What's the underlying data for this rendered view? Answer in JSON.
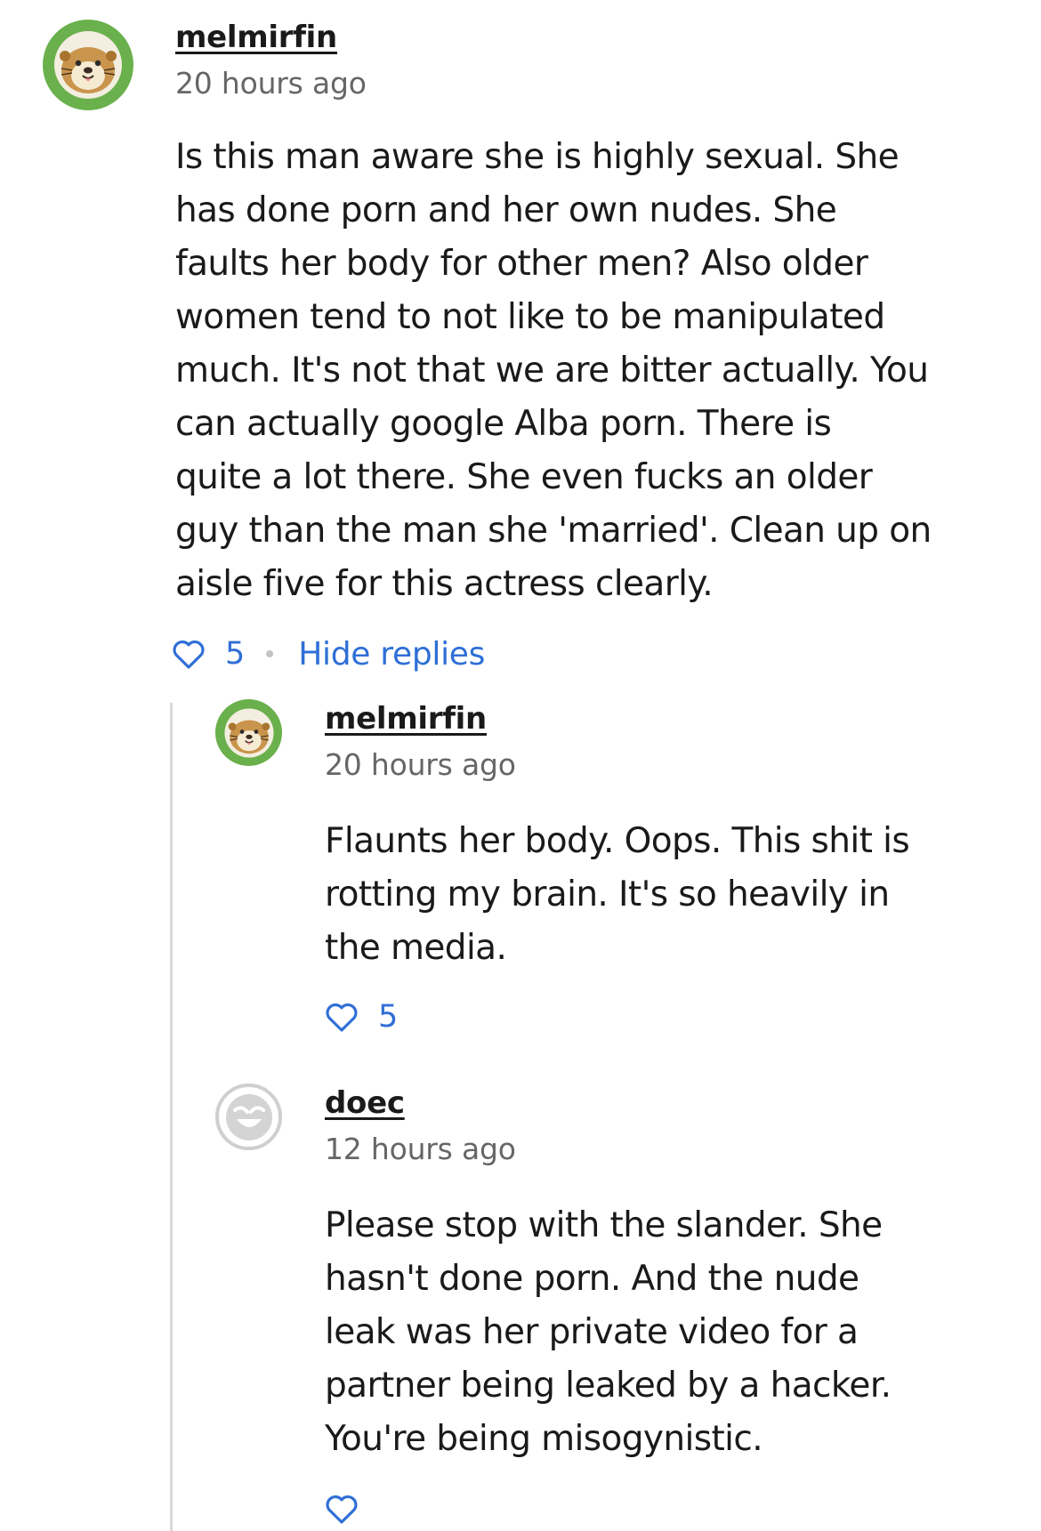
{
  "colors": {
    "link_blue": "#2f6fd6",
    "timestamp_gray": "#666666",
    "otter_avatar_green": "#6ab04c",
    "default_avatar_gray": "#bfbfbf"
  },
  "comment": {
    "username": "melmirfin",
    "timestamp": "20 hours ago",
    "avatar_icon": "otter-avatar-icon",
    "lines": [
      "Is this man aware she is highly sexual. She",
      "has done porn and her own nudes. She",
      "faults her body for other men? Also older",
      "women tend to not like to be manipulated",
      "much. It's not that we are bitter actually. You",
      "can actually google Alba porn. There is",
      "quite a lot there. She even fucks an older",
      "guy than the man she 'married'. Clean up on",
      "aisle five for this actress clearly."
    ],
    "likes": "5",
    "hide_replies_label": "Hide replies"
  },
  "replies": [
    {
      "username": "melmirfin",
      "timestamp": "20 hours ago",
      "avatar_icon": "otter-avatar-icon",
      "lines": [
        "Flaunts her body. Oops. This shit is",
        "rotting my brain. It's so heavily in",
        "the media."
      ],
      "likes": "5"
    },
    {
      "username": "doec",
      "timestamp": "12 hours ago",
      "avatar_icon": "default-smiley-avatar-icon",
      "lines": [
        "Please stop with the slander. She",
        "hasn't done porn. And the nude",
        "leak was her private video for a",
        "partner being leaked by a hacker.",
        "You're being misogynistic."
      ],
      "likes": ""
    }
  ]
}
